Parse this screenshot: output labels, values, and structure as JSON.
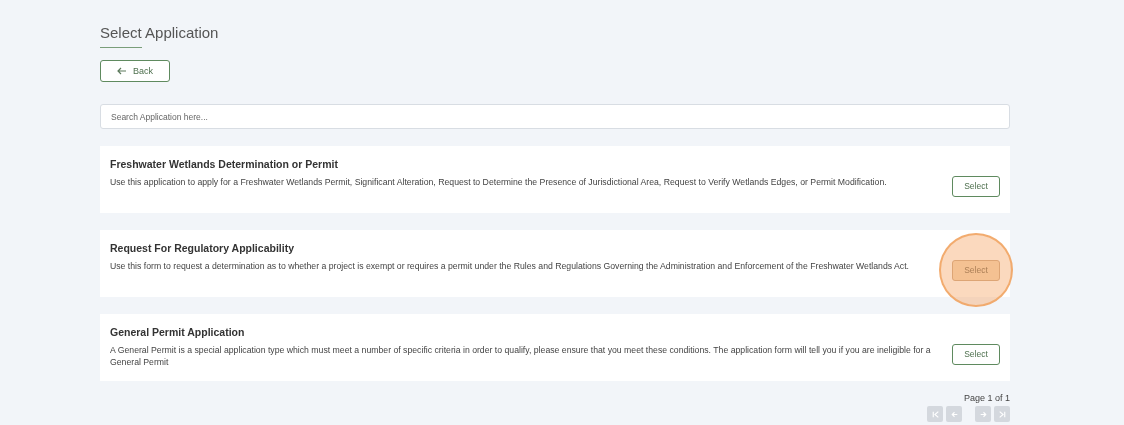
{
  "page_title": "Select Application",
  "back_button": {
    "label": "Back"
  },
  "search": {
    "placeholder": "Search Application here..."
  },
  "applications": [
    {
      "title": "Freshwater Wetlands Determination or Permit",
      "description": "Use this application to apply for a Freshwater Wetlands Permit, Significant Alteration, Request to Determine the Presence of Jurisdictional Area, Request to Verify Wetlands Edges, or Permit Modification.",
      "button": "Select",
      "highlighted": false
    },
    {
      "title": "Request For Regulatory Applicability",
      "description": "Use this form to request a determination as to whether a project is exempt or requires a permit under the Rules and Regulations Governing the Administration and Enforcement of the Freshwater Wetlands Act.",
      "button": "Select",
      "highlighted": true
    },
    {
      "title": "General Permit Application",
      "description": "A General Permit is a special application type which must meet a number of specific criteria in order to qualify, please ensure that you meet these conditions. The application form will tell you if you are ineligible for a General Permit",
      "button": "Select",
      "highlighted": false
    }
  ],
  "pagination": {
    "label": "Page 1 of 1",
    "buttons": [
      {
        "kind": "first",
        "disabled": true
      },
      {
        "kind": "prev",
        "disabled": true
      },
      {
        "kind": "next",
        "disabled": true
      },
      {
        "kind": "last",
        "disabled": true
      }
    ]
  }
}
